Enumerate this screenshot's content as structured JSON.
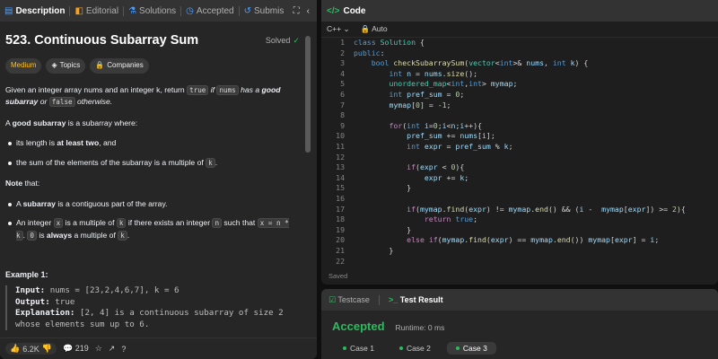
{
  "tabs": [
    {
      "label": "Description",
      "icon": "document-icon",
      "active": true
    },
    {
      "label": "Editorial",
      "icon": "book-icon",
      "active": false
    },
    {
      "label": "Solutions",
      "icon": "flask-icon",
      "active": false
    },
    {
      "label": "Accepted",
      "icon": "clock-icon",
      "active": false
    },
    {
      "label": "Submis",
      "icon": "history-icon",
      "active": false
    }
  ],
  "problem": {
    "title": "523. Continuous Subarray Sum",
    "status": "Solved",
    "tags": [
      "Medium",
      "Topics",
      "Companies"
    ],
    "p1_a": "Given an integer array nums and an integer k, return ",
    "p1_true": "true",
    "p1_b": " if ",
    "p1_nums": "nums",
    "p1_c": " has a ",
    "p1_d": "good subarray",
    "p1_e": " or ",
    "p1_false": "false",
    "p1_f": " otherwise.",
    "p2_a": "A ",
    "p2_b": "good subarray",
    "p2_c": " is a subarray where:",
    "b1_a": "its length is ",
    "b1_b": "at least two",
    "b1_c": ", and",
    "b2_a": "the sum of the elements of the subarray is a multiple of ",
    "b2_k": "k",
    "b2_c": ".",
    "note": "Note",
    "note_b": " that:",
    "n1_a": "A ",
    "n1_b": "subarray",
    "n1_c": " is a contiguous part of the array.",
    "n2_a": "An integer ",
    "n2_x": "x",
    "n2_b": " is a multiple of ",
    "n2_k": "k",
    "n2_c": " if there exists an integer ",
    "n2_n": "n",
    "n2_d": " such that ",
    "n2_expr": "x = n * k",
    "n2_e": ". ",
    "n2_zero": "0",
    "n2_f": " is ",
    "n2_g": "always",
    "n2_h": " a multiple of ",
    "n2_k2": "k",
    "n2_i": "."
  },
  "example": {
    "title": "Example 1:",
    "input_label": "Input:",
    "input_value": " nums = [23,2,4,6,7], k = 6",
    "output_label": "Output:",
    "output_value": " true",
    "explanation_label": "Explanation:",
    "explanation_value": " [2, 4] is a continuous subarray of size 2",
    "explanation_value2": "whose elements sum up to 6."
  },
  "footer": {
    "likes": "6.2K",
    "comments": "219"
  },
  "editor": {
    "title": "Code",
    "language": "C++",
    "mode": "Auto",
    "saved": "Saved",
    "lines": [
      "1",
      "2",
      "3",
      "4",
      "5",
      "6",
      "7",
      "8",
      "9",
      "10",
      "11",
      "12",
      "13",
      "14",
      "15",
      "16",
      "17",
      "18",
      "19",
      "20",
      "21",
      "22"
    ]
  },
  "result": {
    "tab_testcase": "Testcase",
    "tab_result": "Test Result",
    "status": "Accepted",
    "runtime": "Runtime: 0 ms",
    "cases": [
      "Case 1",
      "Case 2",
      "Case 3"
    ]
  },
  "colors": {
    "accent_green": "#2cbb5d",
    "medium": "#ffc01e"
  }
}
